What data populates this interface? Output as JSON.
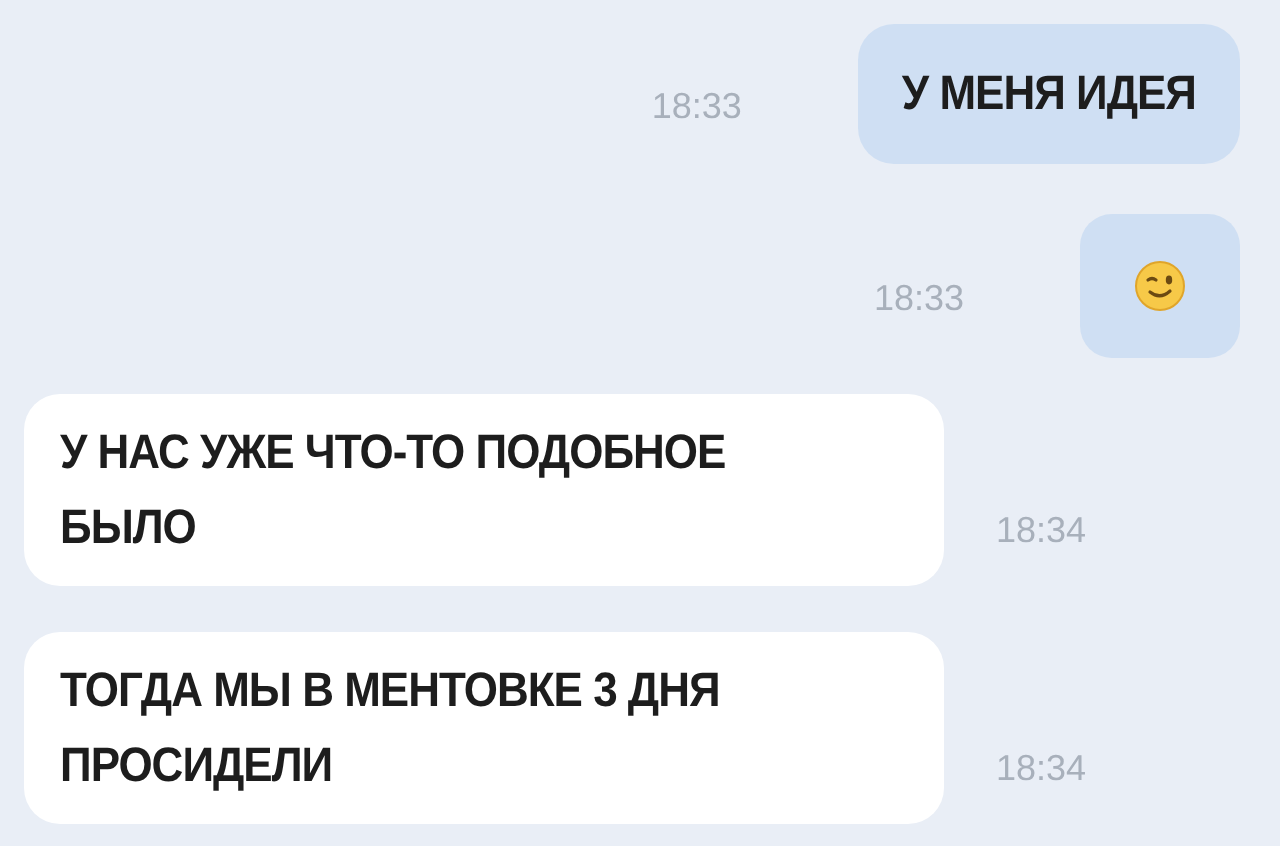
{
  "messages": [
    {
      "kind": "text",
      "outgoing": true,
      "text": "У МЕНЯ ИДЕЯ",
      "time": "18:33"
    },
    {
      "kind": "emoji",
      "outgoing": true,
      "time": "18:33"
    },
    {
      "kind": "text",
      "outgoing": false,
      "text": "У НАС УЖЕ ЧТО-ТО ПОДОБНОЕ\nБЫЛО",
      "time": "18:34"
    },
    {
      "kind": "text",
      "outgoing": false,
      "text": "ТОГДА МЫ В МЕНТОВКЕ 3 ДНЯ\nПРОСИДЕЛИ",
      "time": "18:34"
    }
  ]
}
